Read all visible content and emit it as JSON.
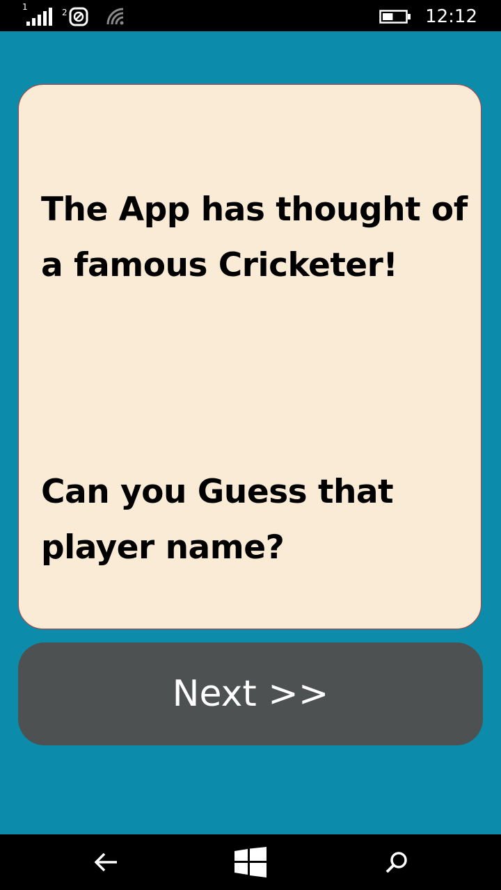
{
  "status_bar": {
    "sim1_label": "1",
    "sim2_label": "2",
    "time": "12:12",
    "icons": [
      "signal-bars-icon",
      "sim2-icon",
      "wifi-icon",
      "battery-icon"
    ],
    "battery_level_percent": 45
  },
  "card": {
    "message_1": "The App has thought of a famous Cricketer!",
    "message_2": "Can you Guess that player name?"
  },
  "next_button": {
    "label": "Next >>"
  },
  "nav_bar": {
    "icons": [
      "back-arrow-icon",
      "windows-start-icon",
      "search-icon"
    ]
  },
  "colors": {
    "background": "#0c8caa",
    "card_bg": "#faebd7",
    "card_border": "#c03a3a",
    "button_bg": "#4d5151",
    "text": "#000000",
    "button_text": "#ffffff"
  }
}
